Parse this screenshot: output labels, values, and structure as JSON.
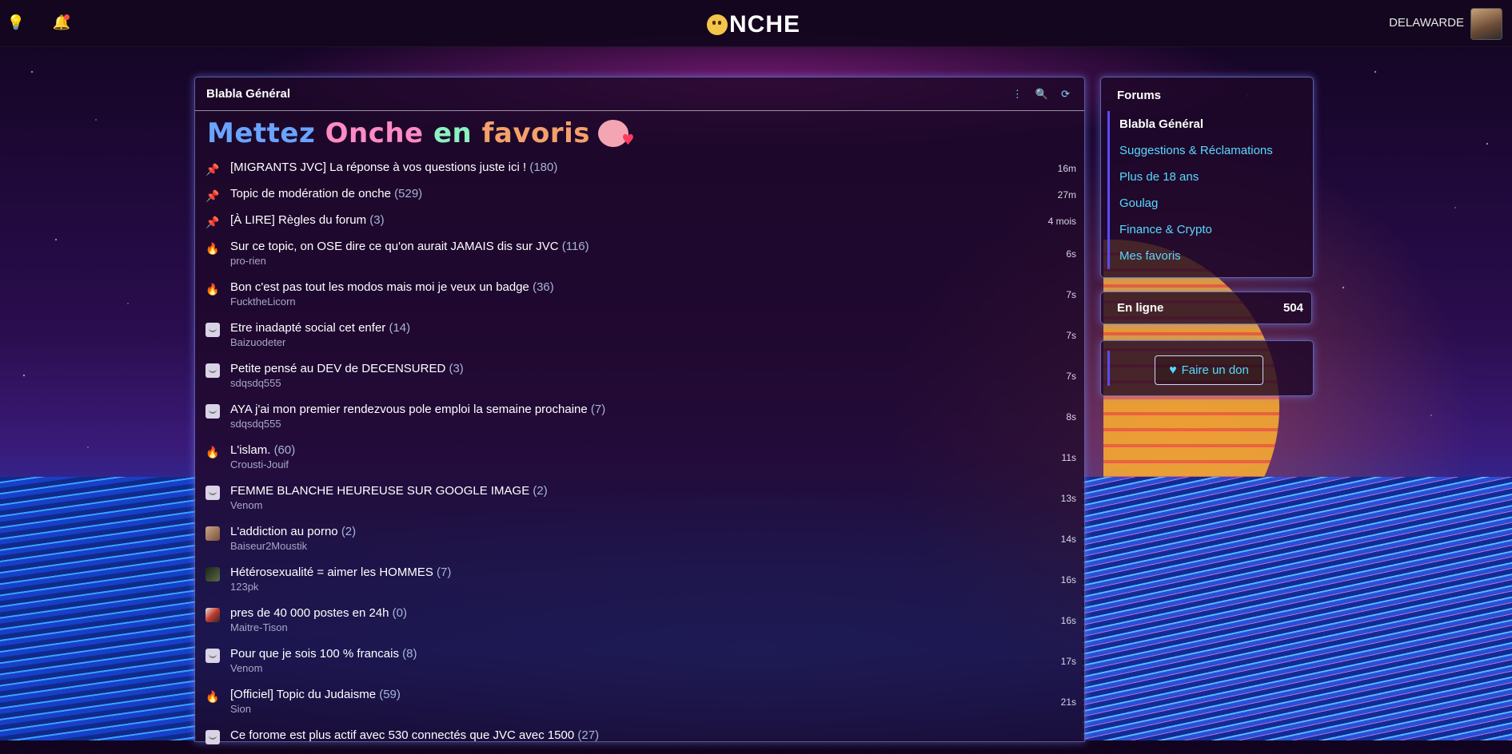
{
  "header": {
    "logo_text": "NCHE",
    "username": "DELAWARDE",
    "icons": [
      "lightbulb-icon",
      "bell-icon"
    ]
  },
  "main": {
    "title": "Blabla Général",
    "banner_words": [
      "Mettez",
      "Onche",
      "en",
      "favoris",
      ""
    ],
    "topics": [
      {
        "icon": "pin-green",
        "title": "[MIGRANTS JVC] La réponse à vos questions juste ici !",
        "count": "(180)",
        "author": "",
        "time": "16m"
      },
      {
        "icon": "pin-green",
        "title": "Topic de modération de onche",
        "count": "(529)",
        "author": "",
        "time": "27m"
      },
      {
        "icon": "pin-red",
        "title": "[À LIRE] Règles du forum",
        "count": "(3)",
        "author": "",
        "time": "4 mois"
      },
      {
        "icon": "flame",
        "title": "Sur ce topic, on OSE dire ce qu'on aurait JAMAIS dis sur JVC",
        "count": "(116)",
        "author": "pro-rien",
        "time": "6s"
      },
      {
        "icon": "flame",
        "title": "Bon c'est pas tout les modos mais moi je veux un badge",
        "count": "(36)",
        "author": "FucktheLicorn",
        "time": "7s"
      },
      {
        "icon": "smiley",
        "title": "Etre inadapté social cet enfer",
        "count": "(14)",
        "author": "Baizuodeter",
        "time": "7s"
      },
      {
        "icon": "smiley",
        "title": "Petite pensé au DEV de DECENSURED",
        "count": "(3)",
        "author": "sdqsdq555",
        "time": "7s"
      },
      {
        "icon": "smiley",
        "title": "AYA j'ai mon premier rendezvous pole emploi la semaine prochaine",
        "count": "(7)",
        "author": "sdqsdq555",
        "time": "8s"
      },
      {
        "icon": "flame",
        "title": "L'islam.",
        "count": "(60)",
        "author": "Crousti-Jouif",
        "time": "11s"
      },
      {
        "icon": "smiley",
        "title": "FEMME BLANCHE HEUREUSE SUR GOOGLE IMAGE",
        "count": "(2)",
        "author": "Venom",
        "time": "13s"
      },
      {
        "icon": "av1",
        "title": "L'addiction au porno",
        "count": "(2)",
        "author": "Baiseur2Moustik",
        "time": "14s"
      },
      {
        "icon": "av2",
        "title": "Hétérosexualité = aimer les HOMMES",
        "count": "(7)",
        "author": "123pk",
        "time": "16s"
      },
      {
        "icon": "av3",
        "title": "pres de 40 000 postes en 24h",
        "count": "(0)",
        "author": "Maitre-Tison",
        "time": "16s"
      },
      {
        "icon": "smiley",
        "title": "Pour que je sois 100 % francais",
        "count": "(8)",
        "author": "Venom",
        "time": "17s"
      },
      {
        "icon": "flame",
        "title": "[Officiel] Topic du Judaisme",
        "count": "(59)",
        "author": "Sion",
        "time": "21s"
      },
      {
        "icon": "smiley",
        "title": "Ce forome est plus actif avec 530 connectés que JVC avec 1500",
        "count": "(27)",
        "author": "",
        "time": ""
      }
    ]
  },
  "sidebar": {
    "forums_title": "Forums",
    "forums": [
      "Blabla Général",
      "Suggestions & Réclamations",
      "Plus de 18 ans",
      "Goulag",
      "Finance & Crypto",
      "Mes favoris"
    ],
    "online_label": "En ligne",
    "online_count": "504",
    "donate_label": "Faire un don"
  }
}
